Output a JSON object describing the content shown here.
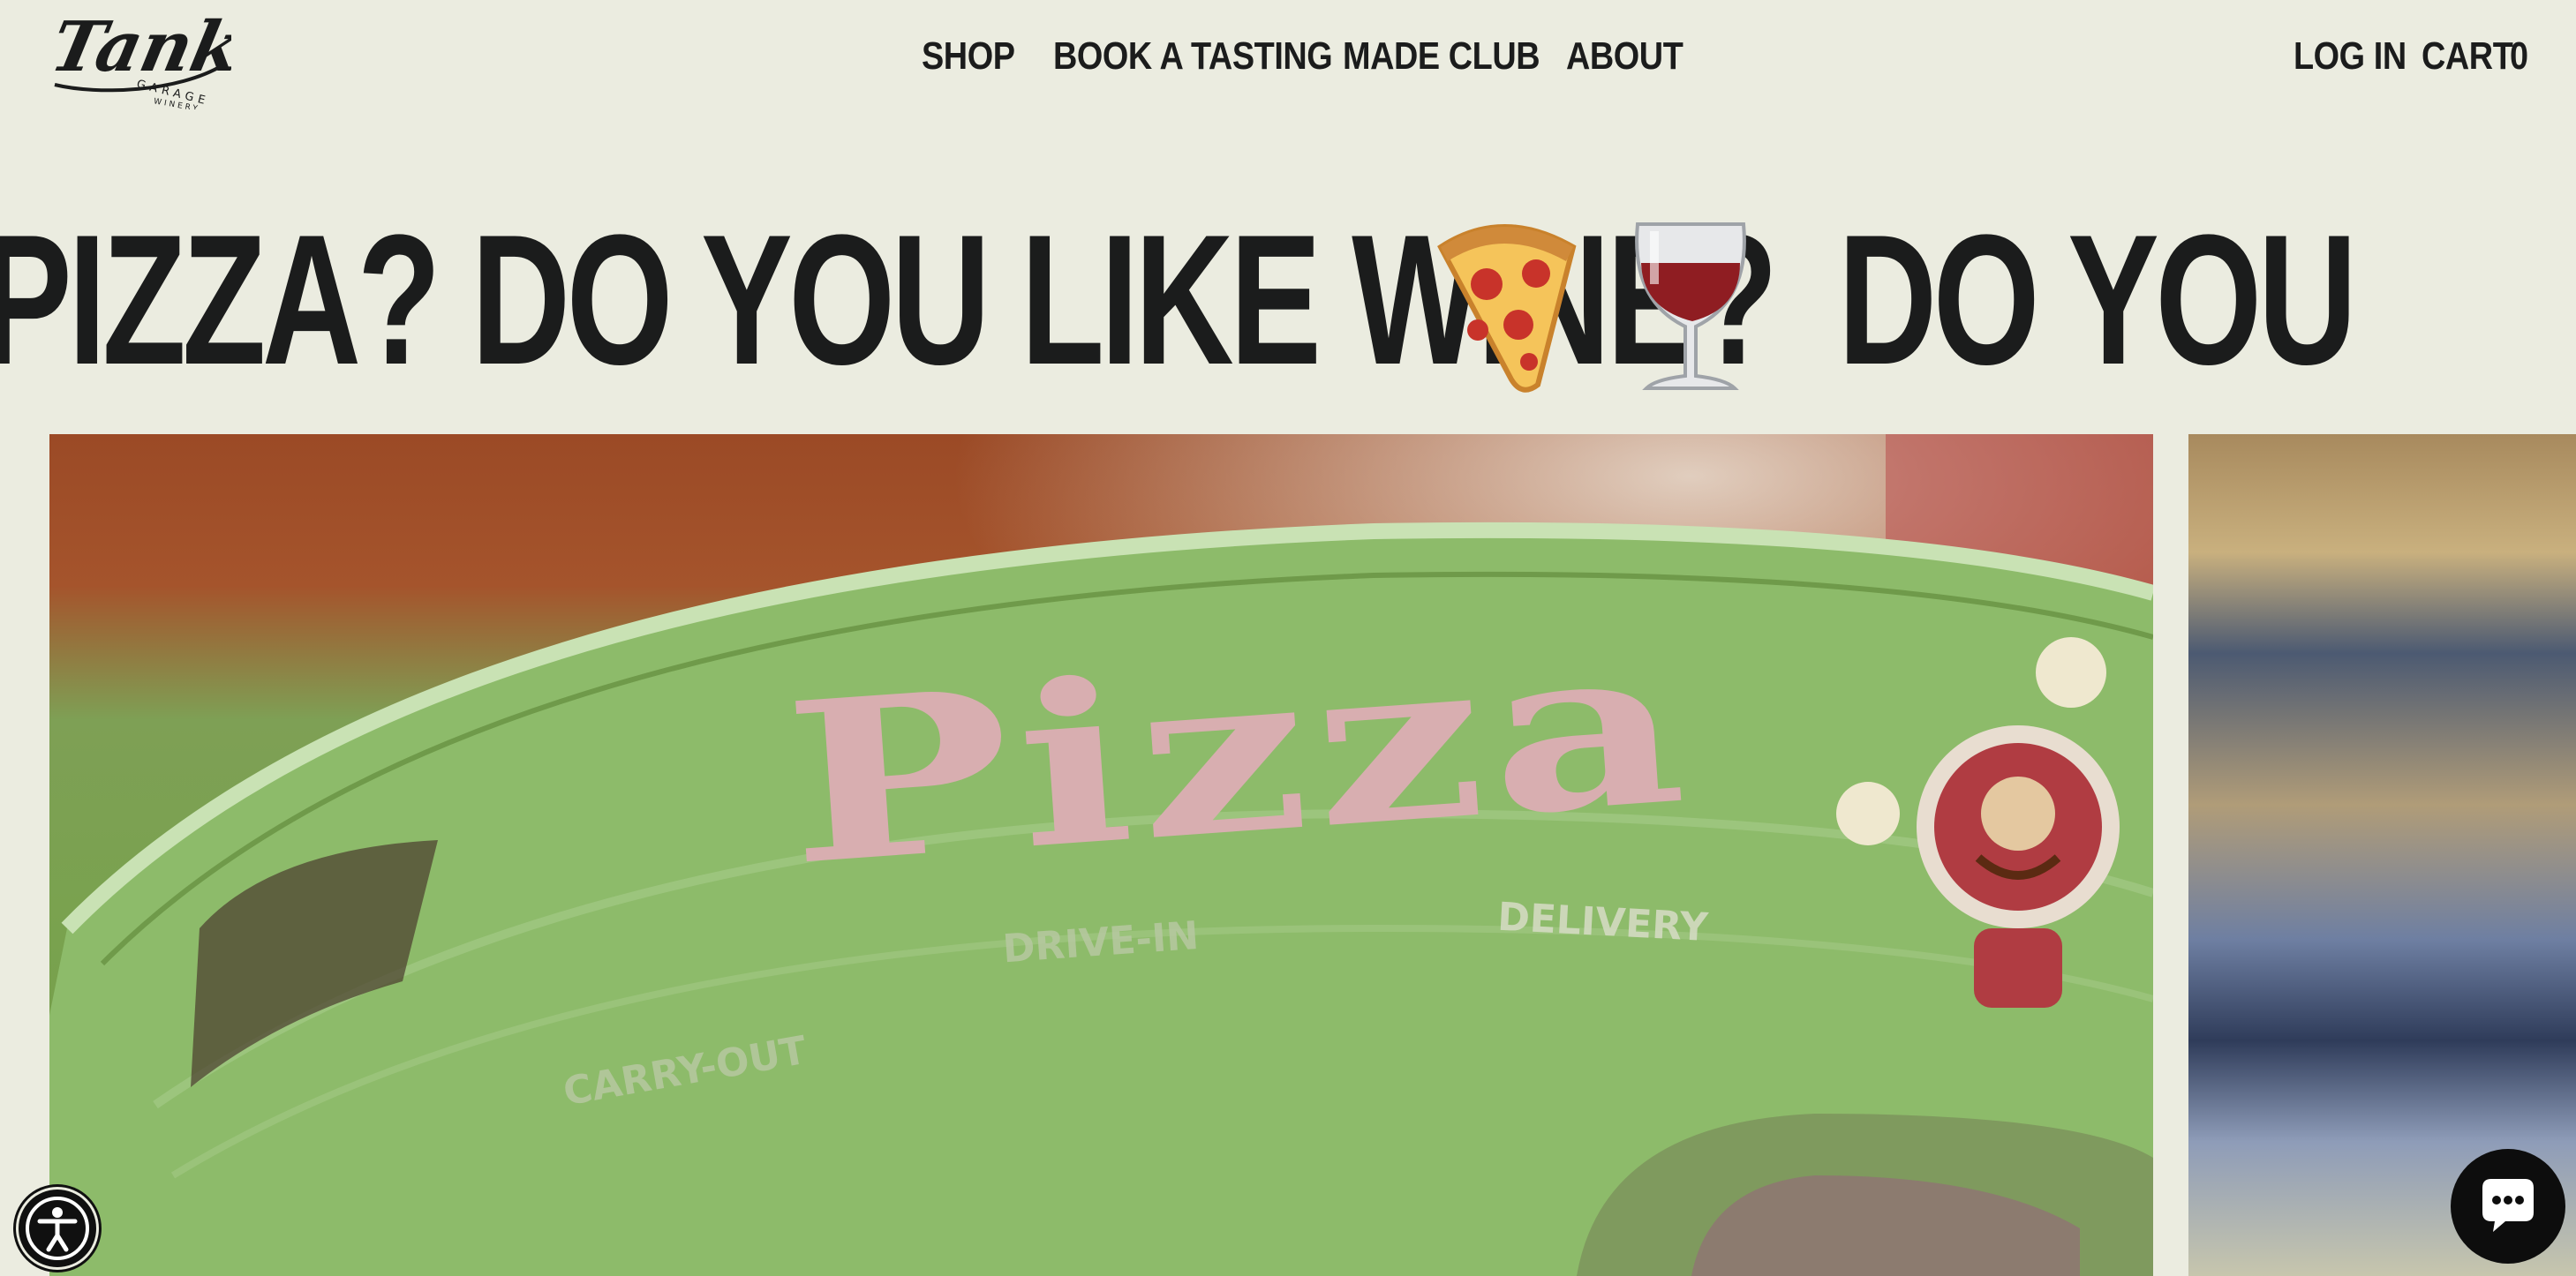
{
  "brand": {
    "logo_script": "Tank",
    "logo_sub_1": "GARAGE",
    "logo_sub_2": "WINERY"
  },
  "nav": {
    "items": [
      {
        "label": "SHOP"
      },
      {
        "label": "BOOK A TASTING"
      },
      {
        "label": "MADE CLUB"
      },
      {
        "label": "ABOUT"
      }
    ]
  },
  "account": {
    "login_label": "LOG IN",
    "cart_label": "CART",
    "cart_count": "0"
  },
  "marquee": {
    "segment_1": "PIZZA? DO YOU LIKE WINE?",
    "segment_2": "DO YOU LIKE P"
  },
  "hero_image": {
    "sign_text": "Pizza",
    "sign_words": [
      "CARRY-OUT",
      "DRIVE-IN",
      "DELIVERY"
    ]
  },
  "colors": {
    "background": "#ebece0",
    "text": "#1b1c1c",
    "widget": "#0d0d0d"
  },
  "icons": {
    "pizza": "pizza-slice-icon",
    "wine": "wine-glass-icon",
    "accessibility": "accessibility-icon",
    "chat": "chat-bubble-icon"
  }
}
